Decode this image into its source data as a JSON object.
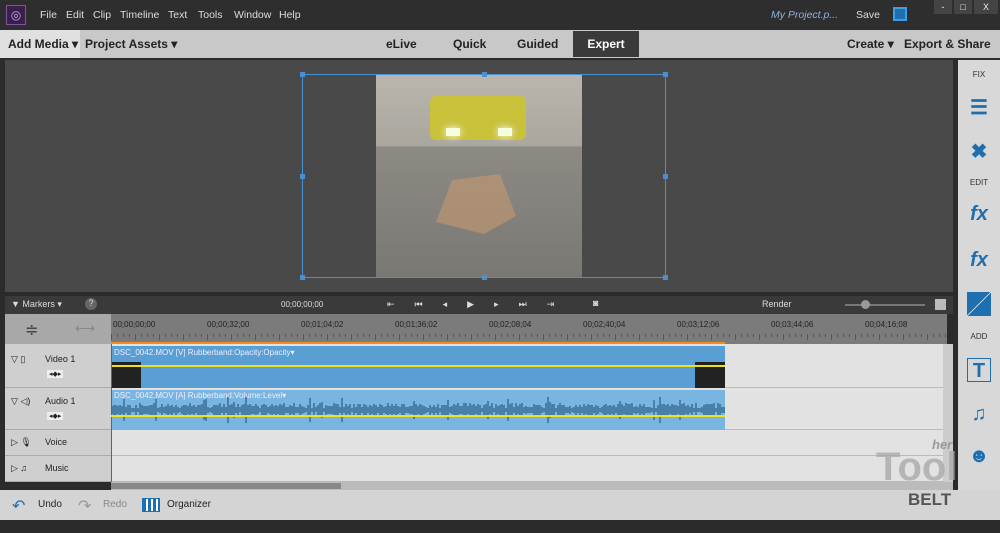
{
  "app": {
    "menu": [
      "File",
      "Edit",
      "Clip",
      "Timeline",
      "Text",
      "Tools",
      "Window",
      "Help"
    ],
    "project_name": "My Project.p...",
    "save_label": "Save",
    "window_controls": [
      "-",
      "□",
      "X"
    ]
  },
  "modebar": {
    "add_media": "Add Media ▾",
    "project_assets": "Project Assets ▾",
    "tabs": [
      "eLive",
      "Quick",
      "Guided",
      "Expert"
    ],
    "active_tab": "Expert",
    "create": "Create ▾",
    "export": "Export & Share"
  },
  "right_panel": {
    "fix_label": "FIX",
    "edit_label": "EDIT",
    "add_label": "ADD",
    "icons": [
      "adjustments-icon",
      "tools-icon",
      "fx-edit-icon",
      "fx-icon",
      "transitions-icon",
      "title-icon",
      "music-icon",
      "graphics-icon"
    ]
  },
  "timeline": {
    "markers_label": "Markers ▾",
    "help": "?",
    "timecode": "00;00;00;00",
    "render_label": "Render",
    "ruler_ticks": [
      "00;00;00;00",
      "00;00;32;00",
      "00;01;04;02",
      "00;01;36;02",
      "00;02;08;04",
      "00;02;40;04",
      "00;03;12;06",
      "00;03;44;06",
      "00;04;16;08"
    ],
    "tracks": [
      {
        "name": "Video 1",
        "clip": "DSC_0042.MOV [V] Rubberband:Opacity:Opacity▾"
      },
      {
        "name": "Audio 1",
        "clip": "DSC_0042.MOV [A] Rubberband:Volume:Level▾"
      },
      {
        "name": "Voice"
      },
      {
        "name": "Music"
      }
    ]
  },
  "bottom": {
    "undo": "Undo",
    "redo": "Redo",
    "organizer": "Organizer"
  },
  "watermark": "her Tool BELT",
  "colors": {
    "accent": "#1e6fb0",
    "clip_video": "#5a9fd4",
    "clip_audio": "#7ab4e0",
    "rubberband": "#f0e020",
    "playhead": "#e03020"
  }
}
